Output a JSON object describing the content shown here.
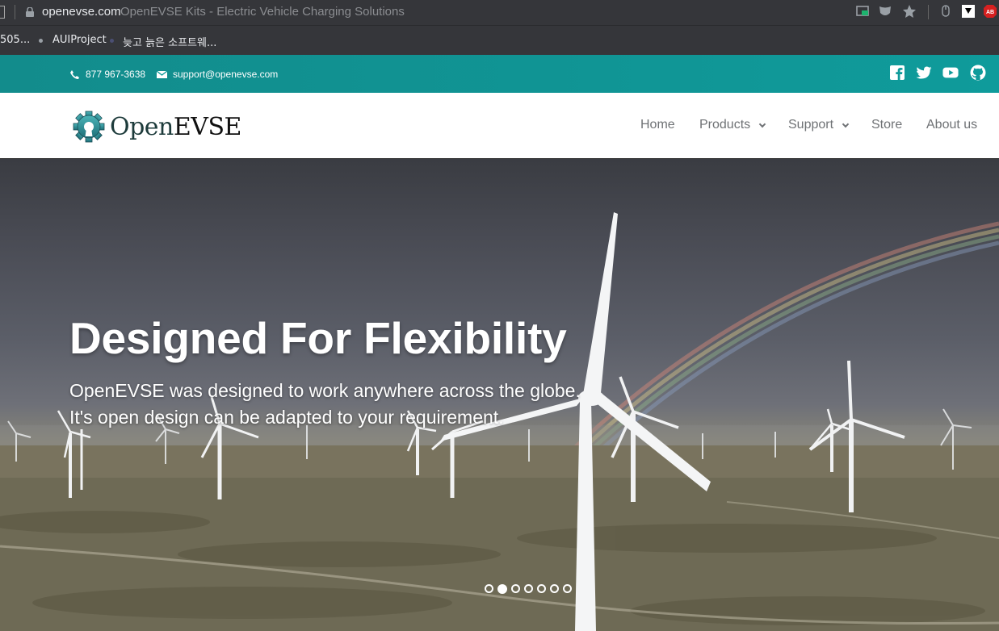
{
  "browser": {
    "url_domain": "openevse.com",
    "page_title": "OpenEVSE Kits - Electric Vehicle Charging Solutions"
  },
  "bookmarks": [
    {
      "label": "505..."
    },
    {
      "label": "AUIProject"
    },
    {
      "label": "늦고 늙은 소프트웨..."
    }
  ],
  "topbar": {
    "phone": "877 967-3638",
    "email": "support@openevse.com",
    "social_icons": [
      "facebook-icon",
      "twitter-icon",
      "youtube-icon",
      "github-icon"
    ]
  },
  "header": {
    "logo_open": "Open",
    "logo_evse": "EVSE",
    "nav": [
      {
        "label": "Home",
        "dropdown": false
      },
      {
        "label": "Products",
        "dropdown": true
      },
      {
        "label": "Support",
        "dropdown": true
      },
      {
        "label": "Store",
        "dropdown": false
      },
      {
        "label": "About us",
        "dropdown": false
      }
    ]
  },
  "hero": {
    "title": "Designed For Flexibility",
    "line1": "OpenEVSE was designed to work anywhere across the globe.",
    "line2": "It's open design can be adapted to your requirement.",
    "slide_count": 7,
    "active_slide": 2
  },
  "colors": {
    "teal": "#0f9b9b",
    "nav_text": "#6f7275"
  }
}
